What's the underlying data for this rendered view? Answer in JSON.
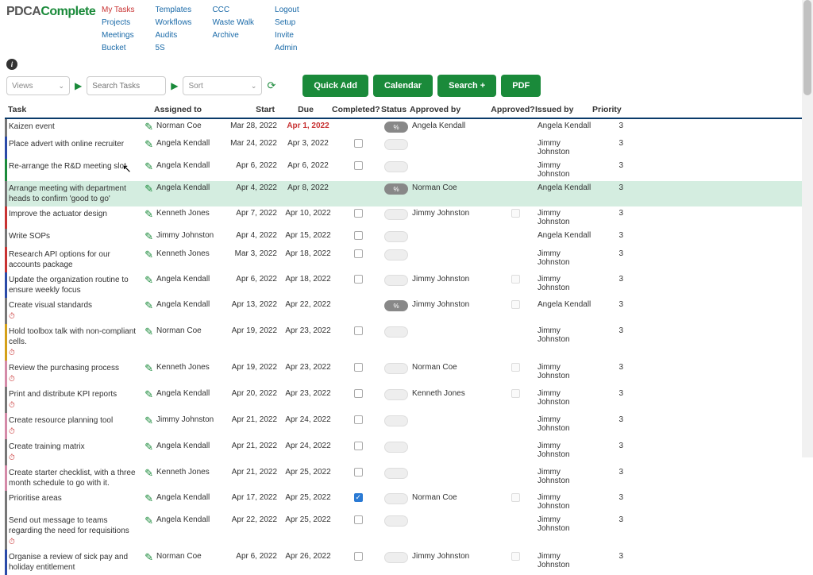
{
  "logo": {
    "a": "PDCA",
    "b": "Complete"
  },
  "nav": {
    "col1": [
      "My Tasks",
      "Projects",
      "Meetings",
      "Bucket"
    ],
    "col2": [
      "Templates",
      "Workflows",
      "Audits",
      "5S"
    ],
    "col3": [
      "CCC",
      "Waste Walk",
      "Archive"
    ],
    "col4": [
      "Logout",
      "Setup",
      "Invite",
      "Admin"
    ]
  },
  "toolbar": {
    "views": "Views",
    "search_ph": "Search Tasks",
    "sort": "Sort",
    "quick_add": "Quick Add",
    "calendar": "Calendar",
    "search_btn": "Search +",
    "pdf": "PDF"
  },
  "headers": {
    "task": "Task",
    "assigned": "Assigned to",
    "start": "Start",
    "due": "Due",
    "completed": "Completed?",
    "status": "Status",
    "approvedby": "Approved by",
    "approved": "Approved?",
    "issued": "Issued by",
    "priority": "Priority"
  },
  "rows": [
    {
      "bl": "bl-grey",
      "task": "Kaizen event",
      "assigned": "Norman Coe",
      "start": "Mar 28, 2022",
      "due": "Apr 1, 2022",
      "due_overdue": true,
      "completed": "none",
      "status": "filled",
      "approvedby": "Angela Kendall",
      "approved": "none",
      "issued": "Angela Kendall",
      "priority": "3"
    },
    {
      "bl": "bl-blue",
      "task": "Place advert with online recruiter",
      "assigned": "Angela Kendall",
      "start": "Mar 24, 2022",
      "due": "Apr 3, 2022",
      "completed": "box",
      "status": "empty",
      "approvedby": "",
      "approved": "none",
      "issued": "Jimmy Johnston",
      "priority": "3"
    },
    {
      "bl": "bl-green",
      "task": "Re-arrange the R&D meeting slot",
      "assigned": "Angela Kendall",
      "start": "Apr 6, 2022",
      "due": "Apr 6, 2022",
      "completed": "box",
      "status": "empty",
      "approvedby": "",
      "approved": "none",
      "issued": "Jimmy Johnston",
      "priority": "3"
    },
    {
      "bl": "bl-grey",
      "highlight": true,
      "task": "Arrange meeting with department heads to confirm 'good to go'",
      "assigned": "Angela Kendall",
      "start": "Apr 4, 2022",
      "due": "Apr 8, 2022",
      "completed": "none",
      "status": "filled",
      "approvedby": "Norman Coe",
      "approved": "none",
      "issued": "Angela Kendall",
      "priority": "3"
    },
    {
      "bl": "bl-red",
      "task": "Improve the actuator design",
      "assigned": "Kenneth Jones",
      "start": "Apr 7, 2022",
      "due": "Apr 10, 2022",
      "completed": "box",
      "status": "empty",
      "approvedby": "Jimmy Johnston",
      "approved": "gray",
      "issued": "Jimmy Johnston",
      "priority": "3"
    },
    {
      "bl": "bl-grey",
      "task": "Write SOPs",
      "assigned": "Jimmy Johnston",
      "start": "Apr 4, 2022",
      "due": "Apr 15, 2022",
      "completed": "box",
      "status": "empty",
      "approvedby": "",
      "approved": "none",
      "issued": "Angela Kendall",
      "priority": "3"
    },
    {
      "bl": "bl-red",
      "task": "Research API options for our accounts package",
      "assigned": "Kenneth Jones",
      "start": "Mar 3, 2022",
      "due": "Apr 18, 2022",
      "completed": "box",
      "status": "empty",
      "approvedby": "",
      "approved": "none",
      "issued": "Jimmy Johnston",
      "priority": "3"
    },
    {
      "bl": "bl-blue",
      "task": "Update the organization routine to ensure weekly focus",
      "assigned": "Angela Kendall",
      "start": "Apr 6, 2022",
      "due": "Apr 18, 2022",
      "completed": "box",
      "status": "empty",
      "approvedby": "Jimmy Johnston",
      "approved": "gray",
      "issued": "Jimmy Johnston",
      "priority": "3"
    },
    {
      "bl": "bl-grey",
      "task": "Create visual standards",
      "clock": true,
      "assigned": "Angela Kendall",
      "start": "Apr 13, 2022",
      "due": "Apr 22, 2022",
      "completed": "none",
      "status": "filled",
      "approvedby": "Jimmy Johnston",
      "approved": "gray",
      "issued": "Angela Kendall",
      "priority": "3"
    },
    {
      "bl": "bl-yellow",
      "task": "Hold toolbox talk with non-compliant cells.",
      "clock": true,
      "assigned": "Norman Coe",
      "start": "Apr 19, 2022",
      "due": "Apr 23, 2022",
      "completed": "box",
      "status": "empty",
      "approvedby": "",
      "approved": "none",
      "issued": "Jimmy Johnston",
      "priority": "3"
    },
    {
      "bl": "bl-pink",
      "task": "Review the purchasing process",
      "clock": true,
      "assigned": "Kenneth Jones",
      "start": "Apr 19, 2022",
      "due": "Apr 23, 2022",
      "completed": "box",
      "status": "empty",
      "approvedby": "Norman Coe",
      "approved": "gray",
      "issued": "Jimmy Johnston",
      "priority": "3"
    },
    {
      "bl": "bl-grey",
      "task": "Print and distribute KPI reports",
      "clock": true,
      "assigned": "Angela Kendall",
      "start": "Apr 20, 2022",
      "due": "Apr 23, 2022",
      "completed": "box",
      "status": "empty",
      "approvedby": "Kenneth Jones",
      "approved": "gray",
      "issued": "Jimmy Johnston",
      "priority": "3"
    },
    {
      "bl": "bl-pink",
      "task": "Create resource planning tool",
      "clock": true,
      "assigned": "Jimmy Johnston",
      "start": "Apr 21, 2022",
      "due": "Apr 24, 2022",
      "completed": "box",
      "status": "empty",
      "approvedby": "",
      "approved": "none",
      "issued": "Jimmy Johnston",
      "priority": "3"
    },
    {
      "bl": "bl-grey",
      "task": "Create training matrix",
      "clock": true,
      "assigned": "Angela Kendall",
      "start": "Apr 21, 2022",
      "due": "Apr 24, 2022",
      "completed": "box",
      "status": "empty",
      "approvedby": "",
      "approved": "none",
      "issued": "Jimmy Johnston",
      "priority": "3"
    },
    {
      "bl": "bl-pink",
      "task": "Create starter checklist, with a three month schedule to go with it.",
      "assigned": "Kenneth Jones",
      "start": "Apr 21, 2022",
      "due": "Apr 25, 2022",
      "completed": "box",
      "status": "empty",
      "approvedby": "",
      "approved": "none",
      "issued": "Jimmy Johnston",
      "priority": "3"
    },
    {
      "bl": "bl-grey",
      "task": "Prioritise areas",
      "assigned": "Angela Kendall",
      "start": "Apr 17, 2022",
      "due": "Apr 25, 2022",
      "completed": "checked",
      "status": "empty",
      "approvedby": "Norman Coe",
      "approved": "gray",
      "issued": "Jimmy Johnston",
      "priority": "3"
    },
    {
      "bl": "bl-grey",
      "task": "Send out message to teams regarding the need for requisitions",
      "clock": true,
      "assigned": "Angela Kendall",
      "start": "Apr 22, 2022",
      "due": "Apr 25, 2022",
      "completed": "box",
      "status": "empty",
      "approvedby": "",
      "approved": "none",
      "issued": "Jimmy Johnston",
      "priority": "3"
    },
    {
      "bl": "bl-blue",
      "task": "Organise a review of sick pay and holiday entitlement",
      "assigned": "Norman Coe",
      "start": "Apr 6, 2022",
      "due": "Apr 26, 2022",
      "completed": "box",
      "status": "empty",
      "approvedby": "Jimmy Johnston",
      "approved": "gray",
      "issued": "Jimmy Johnston",
      "priority": "3"
    }
  ]
}
